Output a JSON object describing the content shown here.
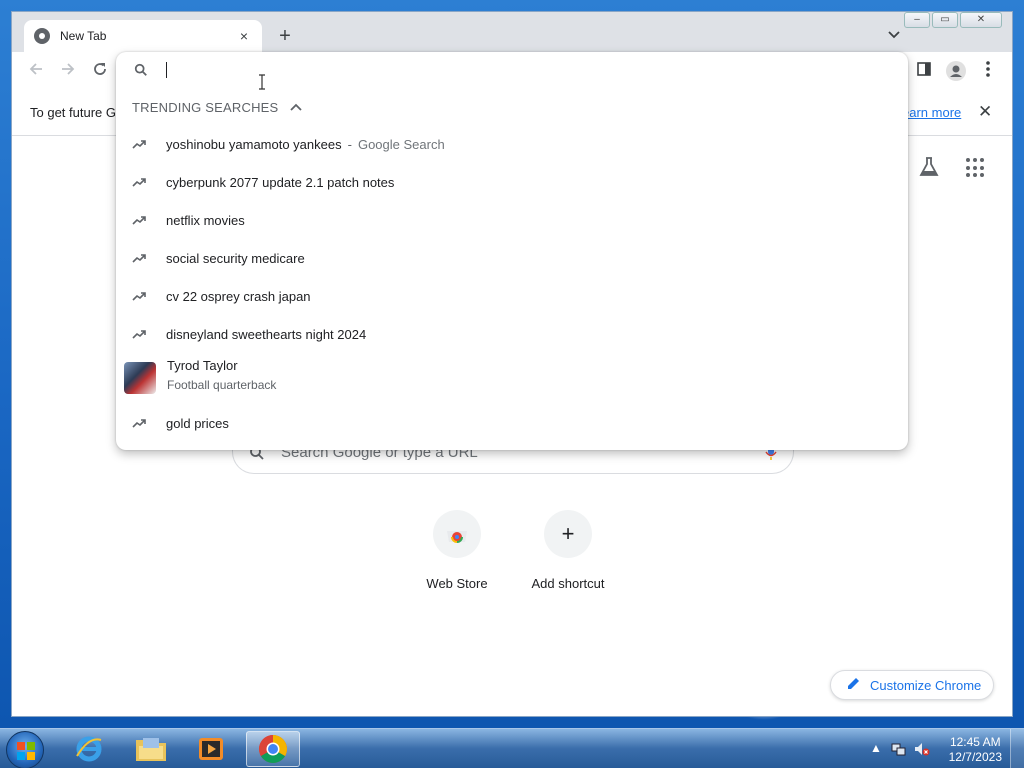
{
  "browser": {
    "tab_title": "New Tab",
    "new_tab_symbol": "+",
    "tab_close_symbol": "×",
    "tab_search_symbol": "⌄"
  },
  "infobar": {
    "message": "To get future G",
    "learn_more": "earn more",
    "close_symbol": "✕"
  },
  "omnibox": {
    "value": "",
    "trending_header": "TRENDING SEARCHES",
    "suggestions": [
      {
        "text": "yoshinobu yamamoto yankees",
        "sep": "-",
        "extra": "Google Search",
        "icon": "trending-icon"
      },
      {
        "text": "cyberpunk 2077 update 2.1 patch notes",
        "icon": "trending-icon"
      },
      {
        "text": "netflix movies",
        "icon": "trending-icon"
      },
      {
        "text": "social security medicare",
        "icon": "trending-icon"
      },
      {
        "text": "cv 22 osprey crash japan",
        "icon": "trending-icon"
      },
      {
        "text": "disneyland sweethearts night 2024",
        "icon": "trending-icon"
      },
      {
        "text": "Tyrod Taylor",
        "sub": "Football quarterback",
        "icon": "thumbnail"
      },
      {
        "text": "gold prices",
        "icon": "trending-icon"
      }
    ]
  },
  "ntp": {
    "search_placeholder": "Search Google or type a URL",
    "shortcuts": [
      {
        "label": "Web Store",
        "icon": "web-store-icon"
      },
      {
        "label": "Add shortcut",
        "icon": "plus-icon",
        "symbol": "+"
      }
    ],
    "customize_label": "Customize Chrome"
  },
  "taskbar": {
    "time": "12:45 AM",
    "date": "12/7/2023",
    "apps": [
      "internet-explorer",
      "file-explorer",
      "media-player",
      "chrome"
    ]
  },
  "colors": {
    "accent": "#1a73e8",
    "desktop": "#1a67c3"
  }
}
